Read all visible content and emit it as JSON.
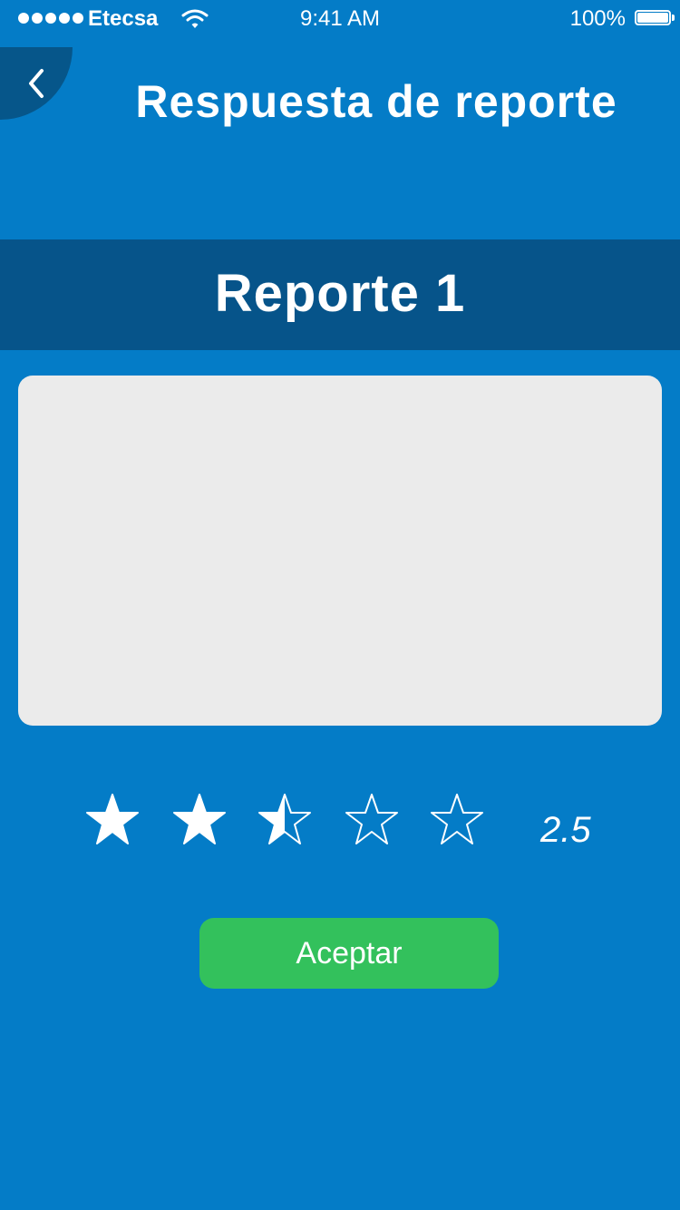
{
  "status_bar": {
    "carrier": "Etecsa",
    "time": "9:41 AM",
    "battery": "100%",
    "signal_dots": 5
  },
  "header": {
    "title": "Respuesta de reporte",
    "back_icon": "chevron-left-icon"
  },
  "report": {
    "title": "Reporte 1",
    "content": ""
  },
  "rating": {
    "value": 2.5,
    "value_label": "2.5",
    "max_stars": 5
  },
  "actions": {
    "accept_label": "Aceptar"
  },
  "colors": {
    "background": "#047CC7",
    "band": "#06548A",
    "back_button": "#06568A",
    "content_box": "#EBEBEB",
    "accept": "#33C15C",
    "text": "#FFFFFF"
  }
}
